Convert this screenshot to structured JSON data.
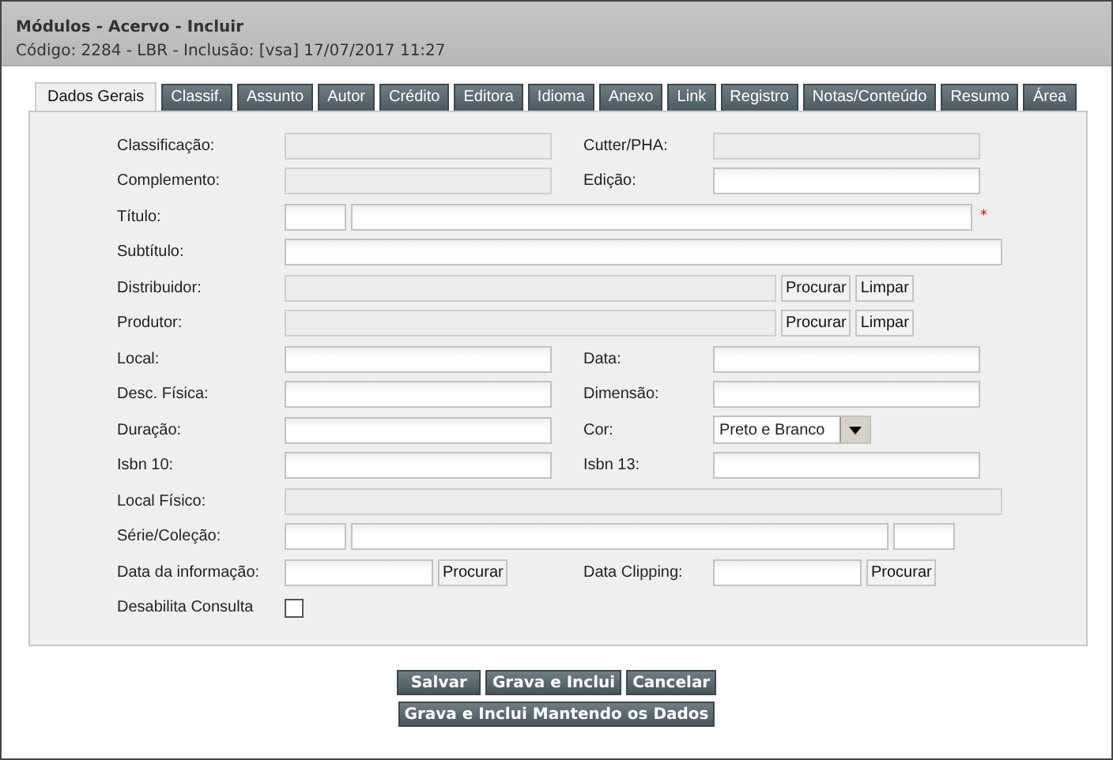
{
  "window": {
    "title": "Módulos - Acervo - Incluir",
    "subtitle": "Código: 2284 - LBR - Inclusão: [vsa] 17/07/2017 11:27"
  },
  "tabs": [
    {
      "label": "Dados Gerais",
      "selected": true
    },
    {
      "label": "Classif.",
      "selected": false
    },
    {
      "label": "Assunto",
      "selected": false
    },
    {
      "label": "Autor",
      "selected": false
    },
    {
      "label": "Crédito",
      "selected": false
    },
    {
      "label": "Editora",
      "selected": false
    },
    {
      "label": "Idioma",
      "selected": false
    },
    {
      "label": "Anexo",
      "selected": false
    },
    {
      "label": "Link",
      "selected": false
    },
    {
      "label": "Registro",
      "selected": false
    },
    {
      "label": "Notas/Conteúdo",
      "selected": false
    },
    {
      "label": "Resumo",
      "selected": false
    },
    {
      "label": "Área",
      "selected": false
    }
  ],
  "rows": [
    {
      "label": "Classificação:",
      "fields": [
        {
          "kind": "text",
          "disabled": true
        }
      ],
      "right": {
        "label": "Cutter/PHA:",
        "fields": [
          {
            "kind": "text",
            "disabled": true
          }
        ]
      }
    },
    {
      "label": "Complemento:",
      "fields": [
        {
          "kind": "text",
          "disabled": true
        }
      ],
      "right": {
        "label": "Edição:",
        "fields": [
          {
            "kind": "text",
            "disabled": false
          }
        ]
      }
    },
    {
      "label": "Título:",
      "fields": [
        {
          "kind": "text",
          "disabled": false
        },
        {
          "kind": "text",
          "disabled": false
        },
        {
          "kind": "required",
          "text": "*"
        }
      ]
    },
    {
      "label": "Subtítulo:",
      "fields": [
        {
          "kind": "text",
          "disabled": false
        }
      ]
    },
    {
      "label": "Distribuidor:",
      "fields": [
        {
          "kind": "text",
          "disabled": true
        },
        {
          "kind": "button",
          "text": "Procurar"
        },
        {
          "kind": "button",
          "text": "Limpar"
        }
      ]
    },
    {
      "label": "Produtor:",
      "fields": [
        {
          "kind": "text",
          "disabled": true
        },
        {
          "kind": "button",
          "text": "Procurar"
        },
        {
          "kind": "button",
          "text": "Limpar"
        }
      ]
    },
    {
      "label": "Local:",
      "fields": [
        {
          "kind": "text",
          "disabled": false
        }
      ],
      "right": {
        "label": "Data:",
        "fields": [
          {
            "kind": "text",
            "disabled": false
          }
        ]
      }
    },
    {
      "label": "Desc. Física:",
      "fields": [
        {
          "kind": "text",
          "disabled": false
        }
      ],
      "right": {
        "label": "Dimensão:",
        "fields": [
          {
            "kind": "text",
            "disabled": false
          }
        ]
      }
    },
    {
      "label": "Duração:",
      "fields": [
        {
          "kind": "text",
          "disabled": false
        }
      ],
      "right": {
        "label": "Cor:",
        "fields": [
          {
            "kind": "select",
            "value": "Preto e Branco"
          }
        ]
      }
    },
    {
      "label": "Isbn 10:",
      "fields": [
        {
          "kind": "text",
          "disabled": false
        }
      ],
      "right": {
        "label": "Isbn 13:",
        "fields": [
          {
            "kind": "text",
            "disabled": false
          }
        ]
      }
    },
    {
      "label": "Local Físico:",
      "fields": [
        {
          "kind": "text",
          "disabled": true
        }
      ]
    },
    {
      "label": "Série/Coleção:",
      "fields": [
        {
          "kind": "text",
          "disabled": false
        },
        {
          "kind": "text",
          "disabled": false
        },
        {
          "kind": "text",
          "disabled": false
        }
      ]
    },
    {
      "label": "Data da informação:",
      "fields": [
        {
          "kind": "text",
          "disabled": false
        },
        {
          "kind": "button",
          "text": "Procurar"
        }
      ],
      "right": {
        "label": "Data Clipping:",
        "fields": [
          {
            "kind": "text",
            "disabled": false
          },
          {
            "kind": "button",
            "text": "Procurar"
          }
        ]
      }
    },
    {
      "label": "Desabilita Consulta",
      "fields": [
        {
          "kind": "checkbox",
          "checked": false
        }
      ]
    }
  ],
  "actions": [
    [
      "Salvar",
      "Grava e Inclui",
      "Cancelar"
    ],
    [
      "Grava e Inclui Mantendo os Dados"
    ]
  ]
}
